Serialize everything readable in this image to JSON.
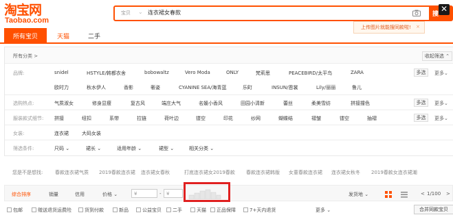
{
  "logo": {
    "cn": "淘宝网",
    "en": "Taobao.com"
  },
  "search": {
    "category": "宝贝",
    "query": "连衣裙女春款",
    "button": "搜",
    "close": "✕"
  },
  "image_tip": {
    "text": "上传图片就能搜同款啦!",
    "close": "×"
  },
  "tabs": [
    "所有宝贝",
    "天猫",
    "二手"
  ],
  "breadcrumb": "所有分类 >",
  "collapse_label": "收起筛选 ⌃",
  "multi_label": "多选",
  "more_label": "更多⌄",
  "brand": {
    "label": "品牌:",
    "row1": [
      "snidel",
      "HSTYLE/韩都衣舍",
      "bobowaltz",
      "Vero Moda",
      "ONLY",
      "梵莉思",
      "PEACEBIRD/太平鸟",
      "ZARA"
    ],
    "row2": [
      "欧时力",
      "秋水伊人",
      "香影",
      "奢姿",
      "CYANINE SEA/海青蓝",
      "乐町",
      "INSUN/恩裳",
      "Lily/丽丽",
      "鲁儿"
    ]
  },
  "hot": {
    "label": "选购热点:",
    "items": [
      "气质淑女",
      "修身显瘦",
      "复古风",
      "端庄大气",
      "名媛小香风",
      "田园小清新",
      "蕾丝",
      "柔美雪纺",
      "拼接撞色"
    ]
  },
  "detail": {
    "label": "服装款式细节:",
    "items": [
      "拼接",
      "纽扣",
      "系带",
      "拉链",
      "荷叶边",
      "镂空",
      "印花",
      "纱网",
      "蝴蝶结",
      "褶皱",
      "镂空",
      "抽褶"
    ]
  },
  "gender": {
    "label": "女装:",
    "items": [
      "连衣裙",
      "大码女装"
    ]
  },
  "filters": {
    "label": "筛选条件:",
    "items": [
      "尺码 ⌄",
      "裙长 ⌄",
      "适用年龄 ⌄",
      "裙型 ⌄",
      "相关分类 ⌄"
    ]
  },
  "related": {
    "label": "您是不是想找:",
    "items": [
      "春款连衣裙气质",
      "2019春款连衣裙",
      "连衣裙女春秋",
      "打底连衣裙女2019春款",
      "春款连衣裙韩版",
      "女童春款连衣裙",
      "连衣裙女秋冬",
      "2019春款女连衣裙潮"
    ]
  },
  "sort": {
    "items": [
      "综合排序",
      "销量",
      "信用",
      "价格 ⌄"
    ],
    "price_from": "¥",
    "price_to": "¥",
    "location": "发货地 ⌄",
    "page": "1/100",
    "prev": "<",
    "next": ">"
  },
  "checks": {
    "items": [
      "包邮",
      "赠送退货运费险",
      "货到付款",
      "新品",
      "公益宝贝",
      "二手",
      "天猫",
      "正品保障",
      "7+天内退货"
    ],
    "more": "更多 ⌄",
    "merge": "合并同款宝贝"
  },
  "colors": {
    "brand": "#ff5000",
    "highlight": "#e02020"
  }
}
